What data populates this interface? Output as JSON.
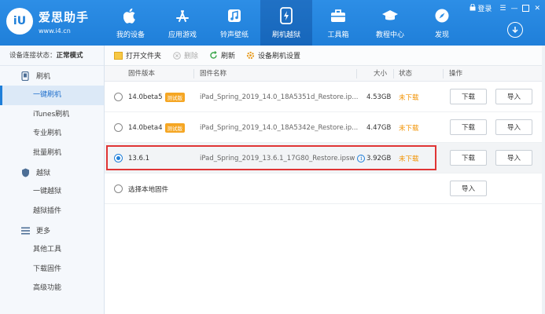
{
  "app": {
    "logo_mark": "iU",
    "name": "爱思助手",
    "url": "www.i4.cn"
  },
  "window": {
    "login_label": "登录"
  },
  "nav": [
    {
      "label": "我的设备",
      "icon": "apple-icon"
    },
    {
      "label": "应用游戏",
      "icon": "app-store-icon"
    },
    {
      "label": "铃声壁纸",
      "icon": "music-icon"
    },
    {
      "label": "刷机越狱",
      "icon": "flash-icon",
      "active": true
    },
    {
      "label": "工具箱",
      "icon": "toolbox-icon"
    },
    {
      "label": "教程中心",
      "icon": "graduation-icon"
    },
    {
      "label": "发现",
      "icon": "compass-icon"
    }
  ],
  "sidebar": {
    "status_label": "设备连接状态：",
    "status_value": "正常模式",
    "groups": [
      {
        "label": "刷机",
        "icon": "phone-icon",
        "items": [
          "一键刷机",
          "iTunes刷机",
          "专业刷机",
          "批量刷机"
        ]
      },
      {
        "label": "越狱",
        "icon": "jailbreak-icon",
        "items": [
          "一键越狱",
          "越狱插件"
        ]
      },
      {
        "label": "更多",
        "icon": "menu-icon",
        "items": [
          "其他工具",
          "下载固件",
          "高级功能"
        ]
      }
    ]
  },
  "toolbar": {
    "open_folder": "打开文件夹",
    "delete": "删除",
    "refresh": "刷新",
    "settings": "设备刷机设置"
  },
  "table": {
    "headers": {
      "version": "固件版本",
      "name": "固件名称",
      "size": "大小",
      "status": "状态",
      "action": "操作"
    },
    "rows": [
      {
        "version": "14.0beta5",
        "tag": "测试版",
        "name": "iPad_Spring_2019_14.0_18A5351d_Restore.ip...",
        "size": "4.53GB",
        "status": "未下载",
        "btn1": "下载",
        "btn2": "导入"
      },
      {
        "version": "14.0beta4",
        "tag": "测试版",
        "name": "iPad_Spring_2019_14.0_18A5342e_Restore.ip...",
        "size": "4.47GB",
        "status": "未下载",
        "btn1": "下载",
        "btn2": "导入"
      },
      {
        "version": "13.6.1",
        "tag": "",
        "name": "iPad_Spring_2019_13.6.1_17G80_Restore.ipsw",
        "size": "3.92GB",
        "status": "未下载",
        "btn1": "下载",
        "btn2": "导入",
        "selected": true
      }
    ],
    "local_row": {
      "label": "选择本地固件",
      "btn": "导入"
    }
  }
}
